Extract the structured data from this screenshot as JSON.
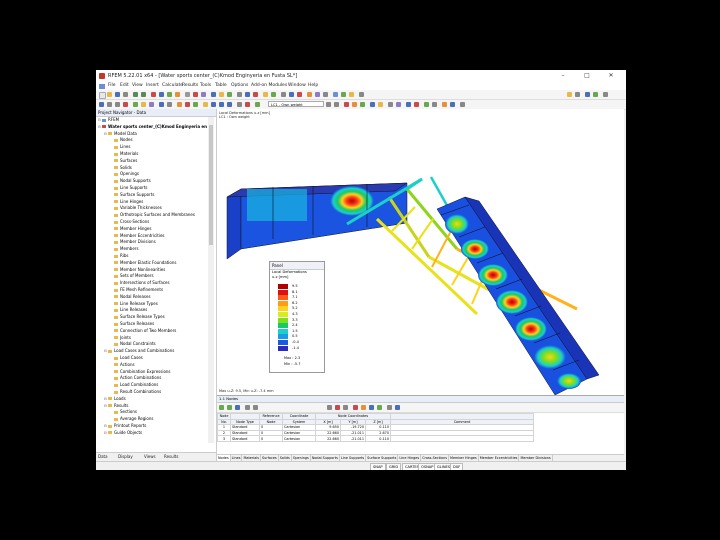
{
  "window": {
    "title": "RFEM 5.22.01 x64 - [Water sports center_(C)Kmod Enginyeria en Fusta SL*]",
    "minimize": "–",
    "maximize": "□",
    "close": "✕"
  },
  "menu": [
    "File",
    "Edit",
    "View",
    "Insert",
    "Calculate",
    "Results",
    "Tools",
    "Table",
    "Options",
    "Add-on Modules",
    "Window",
    "Help"
  ],
  "toolbar": {
    "load_case_select": "LC1 - Own weight"
  },
  "navigator": {
    "header": "Project Navigator - Data",
    "items": [
      {
        "label": "RFEM",
        "level": 0,
        "icon": "blue"
      },
      {
        "label": "Water sports center_(C)Kmod Enginyeria en",
        "level": 0,
        "icon": "red",
        "bold": true
      },
      {
        "label": "Model Data",
        "level": 1
      },
      {
        "label": "Nodes",
        "level": 2
      },
      {
        "label": "Lines",
        "level": 2
      },
      {
        "label": "Materials",
        "level": 2
      },
      {
        "label": "Surfaces",
        "level": 2
      },
      {
        "label": "Solids",
        "level": 2
      },
      {
        "label": "Openings",
        "level": 2
      },
      {
        "label": "Nodal Supports",
        "level": 2
      },
      {
        "label": "Line Supports",
        "level": 2
      },
      {
        "label": "Surface Supports",
        "level": 2
      },
      {
        "label": "Line Hinges",
        "level": 2
      },
      {
        "label": "Variable Thicknesses",
        "level": 2
      },
      {
        "label": "Orthotropic Surfaces and Membranes",
        "level": 2
      },
      {
        "label": "Cross-Sections",
        "level": 2
      },
      {
        "label": "Member Hinges",
        "level": 2
      },
      {
        "label": "Member Eccentricities",
        "level": 2
      },
      {
        "label": "Member Divisions",
        "level": 2
      },
      {
        "label": "Members",
        "level": 2
      },
      {
        "label": "Ribs",
        "level": 2
      },
      {
        "label": "Member Elastic Foundations",
        "level": 2
      },
      {
        "label": "Member Nonlinearities",
        "level": 2
      },
      {
        "label": "Sets of Members",
        "level": 2
      },
      {
        "label": "Intersections of Surfaces",
        "level": 2
      },
      {
        "label": "FE Mesh Refinements",
        "level": 2
      },
      {
        "label": "Nodal Releases",
        "level": 2
      },
      {
        "label": "Line Release Types",
        "level": 2
      },
      {
        "label": "Line Releases",
        "level": 2
      },
      {
        "label": "Surface Release Types",
        "level": 2
      },
      {
        "label": "Surface Releases",
        "level": 2
      },
      {
        "label": "Connection of Two Members",
        "level": 2
      },
      {
        "label": "Joints",
        "level": 2
      },
      {
        "label": "Nodal Constraints",
        "level": 2
      },
      {
        "label": "Load Cases and Combinations",
        "level": 1
      },
      {
        "label": "Load Cases",
        "level": 2
      },
      {
        "label": "Actions",
        "level": 2
      },
      {
        "label": "Combination Expressions",
        "level": 2
      },
      {
        "label": "Action Combinations",
        "level": 2
      },
      {
        "label": "Load Combinations",
        "level": 2
      },
      {
        "label": "Result Combinations",
        "level": 2
      },
      {
        "label": "Loads",
        "level": 1
      },
      {
        "label": "Results",
        "level": 1
      },
      {
        "label": "Sections",
        "level": 2
      },
      {
        "label": "Average Regions",
        "level": 2
      },
      {
        "label": "Printout Reports",
        "level": 1
      },
      {
        "label": "Guide Objects",
        "level": 1
      }
    ],
    "tabs": [
      "Data",
      "Display",
      "Views",
      "Results"
    ]
  },
  "viewport": {
    "info_line1": "Local Deformations u-z [mm]",
    "info_line2": "LC1 : Own weight",
    "footer": "Max u-Z: 9.5, Min u-Z: -7.4 mm"
  },
  "panel": {
    "title": "Panel",
    "subtitle1": "Local Deformations",
    "subtitle2": "u-z [mm]",
    "legend_values": [
      "9.5",
      "8.1",
      "7.1",
      "6.2",
      "5.2",
      "4.3",
      "3.3",
      "2.4",
      "1.5",
      "0.5",
      "-0.4",
      "-1.4"
    ],
    "legend_colors": [
      "#b00000",
      "#e01010",
      "#ff5a1a",
      "#ff9a1a",
      "#ffd21a",
      "#d8ee1a",
      "#7ee01a",
      "#1ac86a",
      "#1ad0c8",
      "#1a9ae8",
      "#1a5ae0",
      "#2a2ac0"
    ],
    "max_label": "Max :",
    "max_value": "2.3",
    "min_label": "Min :",
    "min_value": "-5.7"
  },
  "bottom": {
    "header": "1.1 Nodes",
    "table": {
      "head_row1": [
        "Node",
        "",
        "Reference",
        "Coordinate",
        "Node Coordinates",
        "",
        "",
        " "
      ],
      "head_row2": [
        "No.",
        "Node Type",
        "Node",
        "System",
        "X [m]",
        "Y [m]",
        "Z [m]",
        "Comment"
      ],
      "rows": [
        [
          "1",
          "Standard",
          "0",
          "Cartesian",
          "9.650",
          "-19.720",
          "0.110",
          ""
        ],
        [
          "2",
          "Standard",
          "0",
          "Cartesian",
          "22.660",
          "-21.011",
          "2.670",
          ""
        ],
        [
          "3",
          "Standard",
          "0",
          "Cartesian",
          "22.660",
          "-21.011",
          "0.110",
          ""
        ]
      ]
    },
    "sheet_tabs": [
      "Nodes",
      "Lines",
      "Materials",
      "Surfaces",
      "Solids",
      "Openings",
      "Nodal Supports",
      "Line Supports",
      "Surface Supports",
      "Line Hinges",
      "Cross-Sections",
      "Member Hinges",
      "Member Eccentricities",
      "Member Divisions"
    ]
  },
  "statusbar": [
    "SNAP",
    "GRID",
    "CARTES",
    "OSNAP",
    "GLINES",
    "DXF"
  ]
}
